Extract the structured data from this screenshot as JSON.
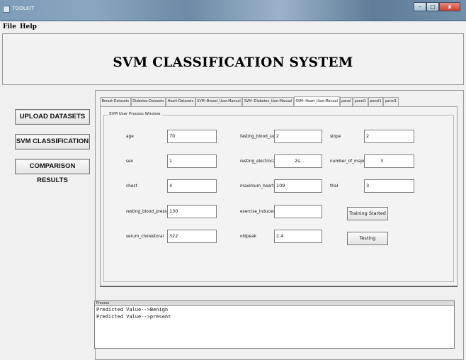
{
  "window": {
    "title": "TOOLKIT",
    "minimize": "–",
    "maximize": "□",
    "close": "x"
  },
  "menu": [
    "File",
    "Help"
  ],
  "header": {
    "title": "SVM CLASSIFICATION SYSTEM"
  },
  "nav": [
    "UPLOAD DATASETS",
    "SVM CLASSIFICATION",
    "COMPARISON RESULTS"
  ],
  "tabs": [
    "Breast-Datasets",
    "Diabetes-Datasets",
    "Heart-Datasets",
    "SVM--Breast_User-Manual",
    "SVM--Diabetes_User-Manual",
    "SVM--Heart_User-Manual",
    "panel",
    "panel1",
    "panel1",
    "panel1"
  ],
  "active_tab": "SVM--Heart_User-Manual",
  "form": {
    "legend": "SVM User Process Window",
    "col1": [
      {
        "label": "age",
        "value": "70"
      },
      {
        "label": "sex",
        "value": "1"
      },
      {
        "label": "chest",
        "value": "4"
      },
      {
        "label": "resting_blood_pressure",
        "value": "130"
      },
      {
        "label": "serum_cholestoral",
        "value": "322"
      }
    ],
    "col2": [
      {
        "label": "fasting_blood_sugar",
        "value": "2"
      },
      {
        "label": "resting_electrocardiogra",
        "value": "2s..."
      },
      {
        "label": "maximum_heart_rate",
        "value": "109"
      },
      {
        "label": "exercise_induced_angina",
        "value": ""
      },
      {
        "label": "oldpeak",
        "value": "2.4"
      }
    ],
    "col3": [
      {
        "label": "slope",
        "value": "2"
      },
      {
        "label": "number_of_major_vessels",
        "value": "3"
      },
      {
        "label": "thal",
        "value": "3"
      }
    ],
    "buttons": {
      "training": "Training Started",
      "testing": "Testing"
    }
  },
  "process": {
    "header": "Process",
    "lines": [
      "Predicted Value-->Benign",
      "Predicted Value-->present"
    ]
  }
}
